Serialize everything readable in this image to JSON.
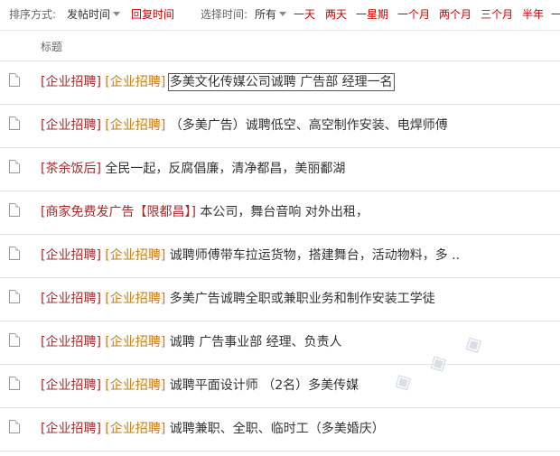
{
  "filters": {
    "sort_label": "排序方式:",
    "sort_option_post_time": "发帖时间",
    "sort_option_reply_time": "回复时间",
    "time_label": "选择时间:",
    "time_selected": "所有",
    "time_options": [
      "一天",
      "两天",
      "一星期",
      "一个月",
      "两个月",
      "三个月",
      "半年",
      "一"
    ]
  },
  "table": {
    "header_title": "标题",
    "rows": [
      {
        "cat1": "[企业招聘]",
        "cat2": "[企业招聘]",
        "title": "多美文化传媒公司诚聘 广告部 经理一名"
      },
      {
        "cat1": "[企业招聘]",
        "cat2": "[企业招聘]",
        "title": "（多美广告）诚聘低空、高空制作安装、电焊师傅"
      },
      {
        "cat1": "[茶余饭后]",
        "cat2": "",
        "title": "全民一起，反腐倡廉，清净都昌，美丽鄱湖"
      },
      {
        "cat1": "[商家免费发广告【限都昌】]",
        "cat2": "",
        "title": "本公司，舞台音响 对外出租，"
      },
      {
        "cat1": "[企业招聘]",
        "cat2": "[企业招聘]",
        "title": "诚聘师傅带车拉运货物，搭建舞台，活动物料，多 .."
      },
      {
        "cat1": "[企业招聘]",
        "cat2": "[企业招聘]",
        "title": "多美广告诚聘全职或兼职业务和制作安装工学徒"
      },
      {
        "cat1": "[企业招聘]",
        "cat2": "[企业招聘]",
        "title": "诚聘 广告事业部 经理、负责人"
      },
      {
        "cat1": "[企业招聘]",
        "cat2": "[企业招聘]",
        "title": "诚聘平面设计师 （2名）多美传媒"
      },
      {
        "cat1": "[企业招聘]",
        "cat2": "[企业招聘]",
        "title": "诚聘兼职、全职、临时工（多美婚庆）"
      }
    ]
  },
  "icons": {
    "thread": "document-icon",
    "dropdown": "caret-down-icon"
  },
  "colors": {
    "accent_red": "#cc0000",
    "category_red": "#a52a2a",
    "category_orange": "#c87b12"
  }
}
